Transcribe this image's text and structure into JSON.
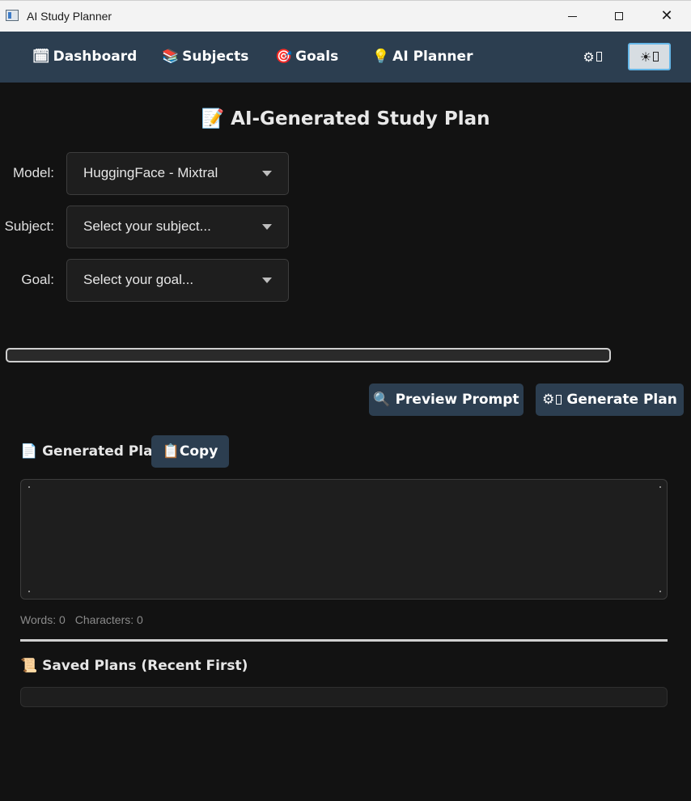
{
  "window": {
    "title": "AI Study Planner",
    "icon": "app-window-icon"
  },
  "nav": {
    "items": [
      {
        "icon": "🗓",
        "label": "Dashboard"
      },
      {
        "icon": "📚",
        "label": "Subjects"
      },
      {
        "icon": "🎯",
        "label": "Goals"
      },
      {
        "icon": "💡",
        "label": "AI Planner"
      }
    ],
    "settings_icon": "⚙",
    "theme_icon": "☀"
  },
  "page": {
    "title_icon": "📝",
    "title": "AI-Generated Study Plan"
  },
  "form": {
    "model": {
      "label": "Model:",
      "value": "HuggingFace - Mixtral"
    },
    "subject": {
      "label": "Subject:",
      "value": "Select your subject..."
    },
    "goal": {
      "label": "Goal:",
      "value": "Select your goal..."
    }
  },
  "progress": {
    "value": 0
  },
  "actions": {
    "preview": {
      "icon": "🔍",
      "label": "Preview Prompt"
    },
    "generate": {
      "icon": "⚙",
      "label": "Generate Plan"
    }
  },
  "generated": {
    "icon": "📄",
    "label": "Generated Plan",
    "copy_icon": "📋",
    "copy_label": "Copy",
    "content": ""
  },
  "stats": {
    "words": "Words: 0",
    "characters": "Characters: 0"
  },
  "saved": {
    "icon": "📜",
    "label": "Saved Plans (Recent First)"
  },
  "colors": {
    "nav_bg": "#2c3e50",
    "bg": "#121212",
    "field_bg": "#1e1e1e"
  }
}
